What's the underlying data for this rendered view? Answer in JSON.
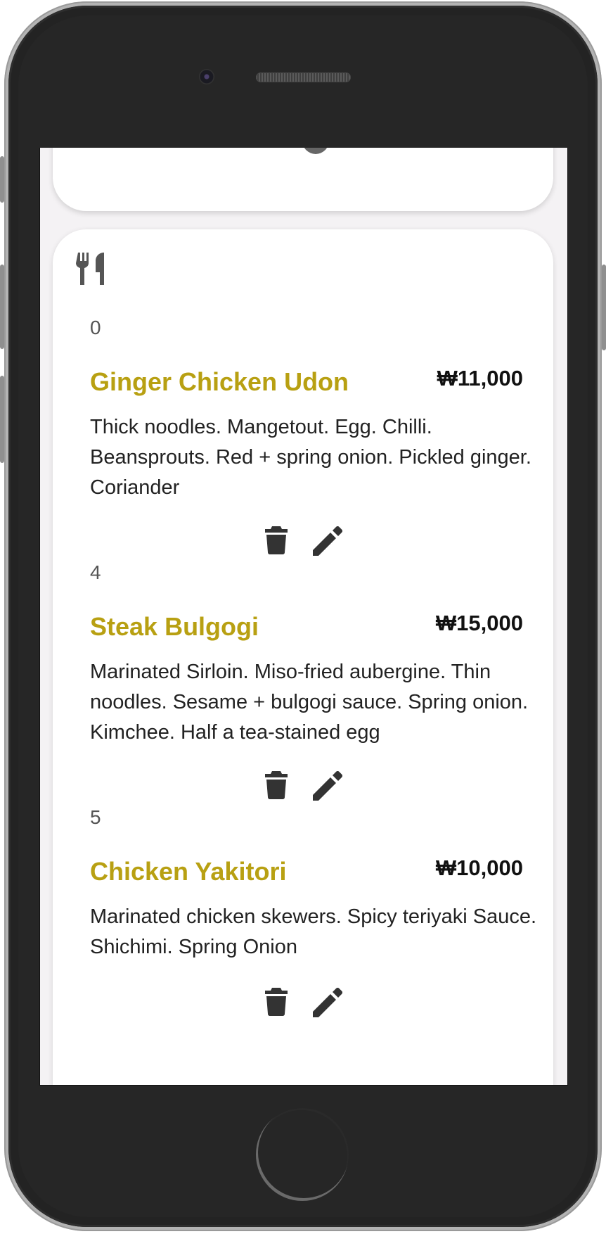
{
  "header": {
    "add_icon": "plus-circle-icon"
  },
  "menu": {
    "section_icon": "utensils-icon",
    "items": [
      {
        "id": "0",
        "name": "Ginger Chicken Udon",
        "price": "₩11,000",
        "description": "Thick noodles. Mangetout. Egg. Chilli. Beansprouts. Red + spring onion. Pickled ginger. Coriander"
      },
      {
        "id": "4",
        "name": "Steak Bulgogi",
        "price": "₩15,000",
        "description": "Marinated Sirloin. Miso-fried aubergine. Thin noodles. Sesame + bulgogi sauce. Spring onion. Kimchee. Half a tea-stained egg"
      },
      {
        "id": "5",
        "name": "Chicken Yakitori",
        "price": "₩10,000",
        "description": "Marinated chicken skewers. Spicy teriyaki Sauce. Shichimi. Spring Onion"
      }
    ]
  },
  "colors": {
    "accent": "#b8a012",
    "icon": "#333333"
  }
}
